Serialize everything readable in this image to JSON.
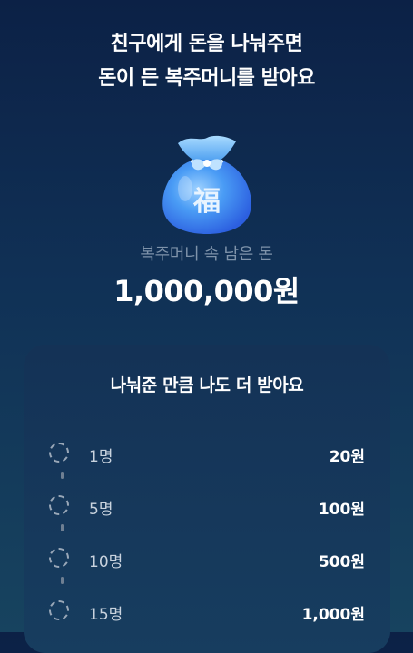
{
  "headline": {
    "line1": "친구에게 돈을 나눠주면",
    "line2": "돈이 든 복주머니를 받아요"
  },
  "pouch": {
    "icon": "lucky-pouch-icon",
    "character": "福",
    "color": "#3f8ef0"
  },
  "balance": {
    "label": "복주머니 속 남은 돈",
    "amount": "1,000,000원"
  },
  "rewards": {
    "title": "나눠준 만큼 나도 더 받아요",
    "items": [
      {
        "count": "1명",
        "reward": "20원"
      },
      {
        "count": "5명",
        "reward": "100원"
      },
      {
        "count": "10명",
        "reward": "500원"
      },
      {
        "count": "15명",
        "reward": "1,000원"
      }
    ]
  },
  "colors": {
    "background_top": "#0c2146",
    "background_bottom": "#17435f",
    "card": "#143256",
    "muted_text": "#7f93aa"
  }
}
